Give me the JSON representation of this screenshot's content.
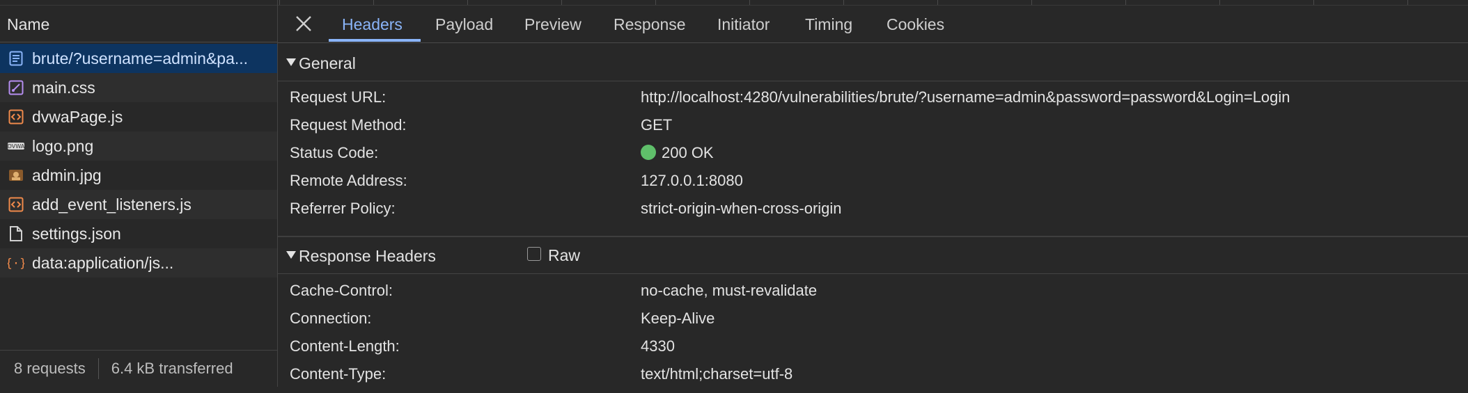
{
  "request_list": {
    "header": "Name",
    "items": [
      {
        "label": "brute/?username=admin&pa...",
        "icon": "document-icon",
        "selected": true
      },
      {
        "label": "main.css",
        "icon": "css-file-icon"
      },
      {
        "label": "dvwaPage.js",
        "icon": "script-file-icon"
      },
      {
        "label": "logo.png",
        "icon": "image-file-icon"
      },
      {
        "label": "admin.jpg",
        "icon": "image-file-icon"
      },
      {
        "label": "add_event_listeners.js",
        "icon": "script-file-icon"
      },
      {
        "label": "settings.json",
        "icon": "file-icon"
      },
      {
        "label": "data:application/js...",
        "icon": "json-file-icon"
      }
    ],
    "status": {
      "requests": "8 requests",
      "transferred": "6.4 kB transferred"
    }
  },
  "tabs": [
    {
      "label": "Headers",
      "active": true
    },
    {
      "label": "Payload"
    },
    {
      "label": "Preview"
    },
    {
      "label": "Response"
    },
    {
      "label": "Initiator"
    },
    {
      "label": "Timing"
    },
    {
      "label": "Cookies"
    }
  ],
  "general": {
    "title": "General",
    "rows": [
      {
        "key": "Request URL:",
        "value": "http://localhost:4280/vulnerabilities/brute/?username=admin&password=password&Login=Login"
      },
      {
        "key": "Request Method:",
        "value": "GET"
      },
      {
        "key": "Status Code:",
        "value": "200 OK"
      },
      {
        "key": "Remote Address:",
        "value": "127.0.0.1:8080"
      },
      {
        "key": "Referrer Policy:",
        "value": "strict-origin-when-cross-origin"
      }
    ]
  },
  "response_headers": {
    "title": "Response Headers",
    "raw_label": "Raw",
    "rows": [
      {
        "key": "Cache-Control:",
        "value": "no-cache, must-revalidate"
      },
      {
        "key": "Connection:",
        "value": "Keep-Alive"
      },
      {
        "key": "Content-Length:",
        "value": "4330"
      },
      {
        "key": "Content-Type:",
        "value": "text/html;charset=utf-8"
      }
    ]
  },
  "colors": {
    "accent": "#8ab4f8",
    "status_ok": "#5fbf6a",
    "selected_row": "#0d3460"
  }
}
